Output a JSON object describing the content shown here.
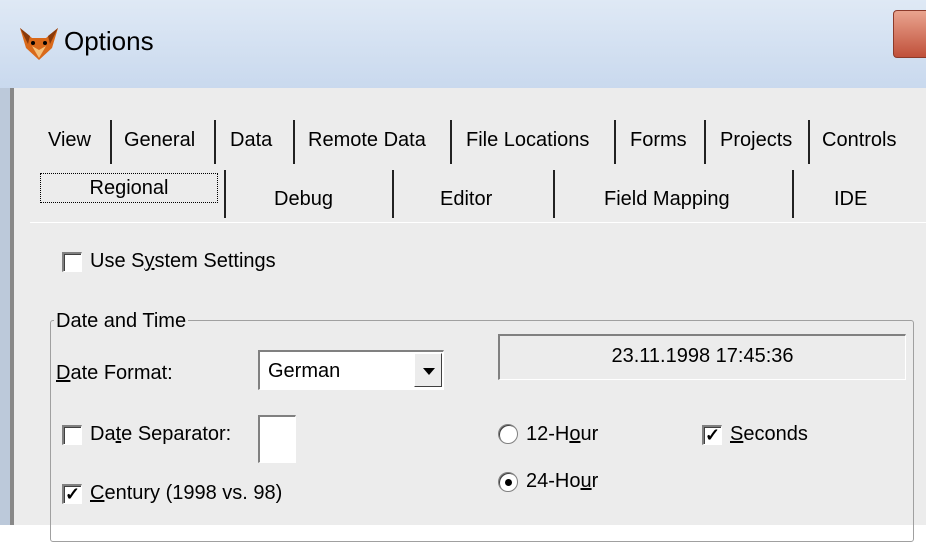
{
  "window": {
    "title": "Options"
  },
  "tabs_row1": [
    "View",
    "General",
    "Data",
    "Remote Data",
    "File Locations",
    "Forms",
    "Projects",
    "Controls"
  ],
  "tabs_row2": [
    "Regional",
    "Debug",
    "Editor",
    "Field Mapping",
    "IDE"
  ],
  "regional": {
    "use_system_settings": {
      "label": "Use System Settings",
      "accel": "y",
      "checked": false
    },
    "group_title": "Date and Time",
    "date_format": {
      "label": "Date Format:",
      "accel": "D",
      "value": "German"
    },
    "date_separator": {
      "label": "Date Separator:",
      "accel": "t",
      "checked": false,
      "value": ""
    },
    "century": {
      "label": "Century (1998 vs. 98)",
      "accel": "C",
      "checked": true
    },
    "preview": "23.11.1998 17:45:36",
    "hour12": {
      "label": "12-Hour",
      "accel": "o",
      "selected": false
    },
    "hour24": {
      "label": "24-Hour",
      "accel": "u",
      "selected": true
    },
    "seconds": {
      "label": "Seconds",
      "accel": "S",
      "checked": true
    }
  }
}
